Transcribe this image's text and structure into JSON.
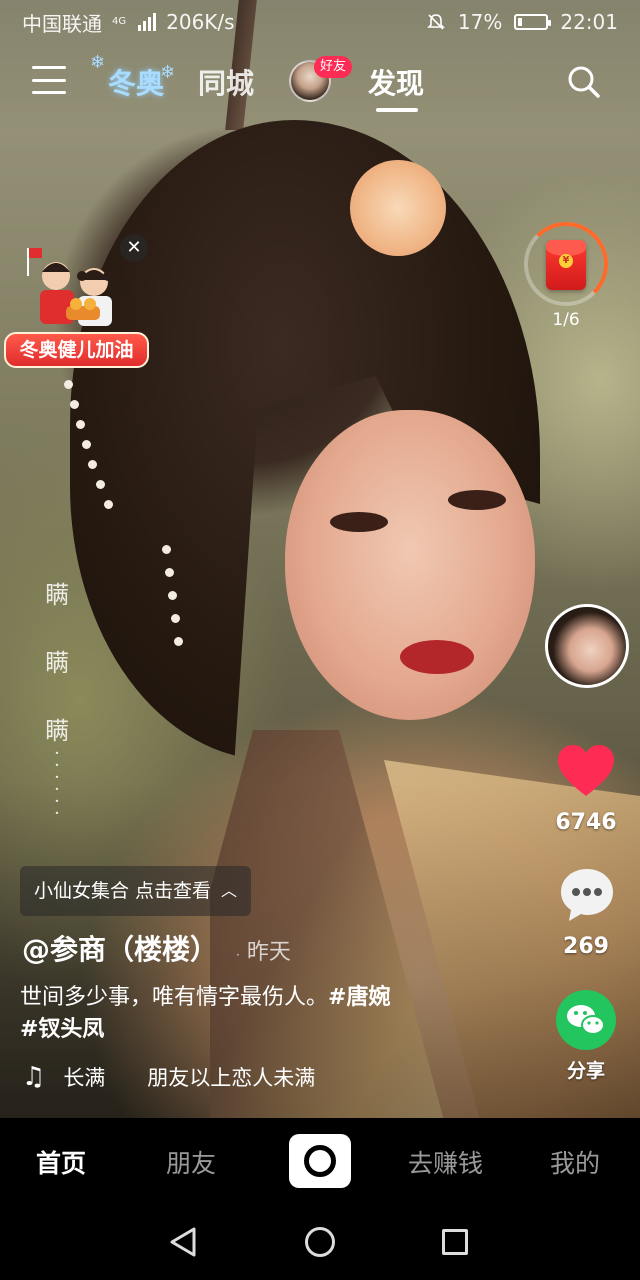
{
  "status_bar": {
    "carrier": "中国联通",
    "network_type": "4G",
    "speed": "206K/s",
    "battery_percent": "17%",
    "battery_level": 0.17,
    "time": "22:01"
  },
  "top_nav": {
    "winter_tab": "冬奥",
    "city_tab": "同城",
    "friend_badge": "好友",
    "discover_tab": "发现",
    "active_tab": "发现"
  },
  "promo": {
    "label": "冬奥健儿加油",
    "close_glyph": "✕"
  },
  "red_packet": {
    "progress": "1/6"
  },
  "video": {
    "vertical_caption": [
      "瞒",
      "瞒",
      "瞒"
    ],
    "likes": "6746",
    "comments": "269",
    "share_label": "分享",
    "collection_label": "小仙女集合 点击查看",
    "author": "@参商（楼楼）",
    "posted": "昨天",
    "description": "世间多少事，唯有情字最伤人。",
    "tags": [
      "#唐婉",
      "#钗头凤"
    ],
    "music": "长满　　朋友以上恋人未满"
  },
  "tab_bar": {
    "home": "首页",
    "friends": "朋友",
    "earn": "去赚钱",
    "me": "我的"
  },
  "colors": {
    "like_red": "#fe2c55",
    "share_green": "#22c55e",
    "packet_red": "#ff3b30"
  },
  "icons": [
    "menu-icon",
    "search-icon",
    "close-icon",
    "red-packet-icon",
    "heart-icon",
    "comment-icon",
    "wechat-icon",
    "music-note-icon",
    "record-icon",
    "back-icon",
    "home-icon",
    "recent-apps-icon"
  ]
}
